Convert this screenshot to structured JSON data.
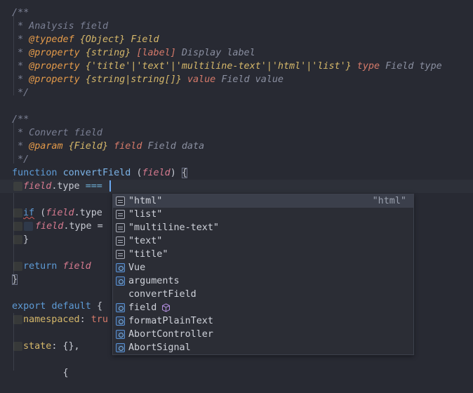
{
  "editor": {
    "l1": "/**",
    "l2_text": " * Analysis field",
    "l3_star": " * ",
    "l3_tag": "@typedef",
    "l3_type": "{Object}",
    "l3_name": "Field",
    "l4_star": " * ",
    "l4_tag": "@property",
    "l4_type": "{string}",
    "l4_name": "[label]",
    "l4_desc": "Display label",
    "l5_star": " * ",
    "l5_tag": "@property",
    "l5_type": "{'title'|'text'|'multiline-text'|'html'|'list'}",
    "l5_name": "type",
    "l5_desc": "Field type",
    "l6_star": " * ",
    "l6_tag": "@property",
    "l6_type": "{string|string[]}",
    "l6_name": "value",
    "l6_desc": "Field value",
    "l7": " */",
    "l9": "/**",
    "l10_text": " * Convert field",
    "l11_star": " * ",
    "l11_tag": "@param",
    "l11_type": "{Field}",
    "l11_name": "field",
    "l11_desc": "Field data",
    "l12": " */",
    "l13_kw": "function",
    "l13_fn": "convertField",
    "l13_open": " (",
    "l13_param": "field",
    "l13_close": ") ",
    "l13_brace": "{",
    "l14_obj": "field",
    "l14_prop": ".type ",
    "l14_op": "===",
    "l16_kw": "if",
    "l16_paren": " (",
    "l16_obj": "field",
    "l16_prop": ".type",
    "l17_obj": "field",
    "l17_prop": ".type =",
    "l18": "}",
    "l20_kw": "return",
    "l20_obj": "field",
    "l21": "}",
    "l23_kw1": "export",
    "l23_kw2": "default",
    "l23_brace": "{",
    "l24_key": "namespaced",
    "l24_colon": ": ",
    "l24_val": "tru",
    "l26_key": "state",
    "l26_rest": ": {},",
    "l28_partial": "         {"
  },
  "autocomplete": {
    "items": [
      {
        "label": "\"html\"",
        "icon": "text-value-icon",
        "hint": "\"html\""
      },
      {
        "label": "\"list\"",
        "icon": "text-value-icon"
      },
      {
        "label": "\"multiline-text\"",
        "icon": "text-value-icon"
      },
      {
        "label": "\"text\"",
        "icon": "text-value-icon"
      },
      {
        "label": "\"title\"",
        "icon": "text-value-icon"
      },
      {
        "label": "Vue",
        "icon": "variable-icon"
      },
      {
        "label": "arguments",
        "icon": "variable-icon"
      },
      {
        "label": "convertField",
        "icon": "method-cube-icon"
      },
      {
        "label": "field",
        "icon": "variable-icon"
      },
      {
        "label": "formatPlainText",
        "icon": "variable-icon"
      },
      {
        "label": "AbortController",
        "icon": "variable-icon"
      },
      {
        "label": "AbortSignal",
        "icon": "variable-icon"
      }
    ]
  },
  "colors": {
    "background": "#282a33",
    "popup_background": "#2b2d35",
    "selection": "#3b3f4b",
    "caret": "#6aa8f0"
  }
}
